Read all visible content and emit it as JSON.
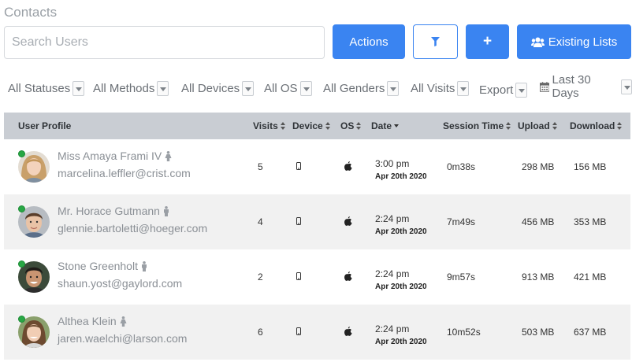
{
  "page": {
    "title": "Contacts"
  },
  "search": {
    "placeholder": "Search Users",
    "value": ""
  },
  "toolbar": {
    "actions_label": "Actions",
    "filter_icon": "filter-icon",
    "add_label": "+",
    "existing_lists_label": "Existing Lists",
    "existing_lists_icon": "users-icon",
    "accent_color": "#3a84f1"
  },
  "filters": {
    "statuses": "All Statuses",
    "methods": "All Methods",
    "devices": "All Devices",
    "os": "All OS",
    "genders": "All Genders",
    "visits": "All Visits",
    "export": "Export",
    "date_range": "Last 30 Days"
  },
  "table": {
    "headers": {
      "profile": "User Profile",
      "visits": "Visits",
      "device": "Device",
      "os": "OS",
      "date": "Date",
      "session": "Session Time",
      "upload": "Upload",
      "download": "Download"
    },
    "rows": [
      {
        "name": "Miss Amaya Frami IV",
        "email": "marcelina.leffler@crist.com",
        "visits": "5",
        "device": "mobile-icon",
        "os": "apple-icon",
        "time": "3:00 pm",
        "date": "Apr 20th 2020",
        "session": "0m38s",
        "upload": "298 MB",
        "download": "156 MB",
        "online": true
      },
      {
        "name": "Mr. Horace Gutmann",
        "email": "glennie.bartoletti@hoeger.com",
        "visits": "4",
        "device": "mobile-icon",
        "os": "apple-icon",
        "time": "2:24 pm",
        "date": "Apr 20th 2020",
        "session": "7m49s",
        "upload": "456 MB",
        "download": "353 MB",
        "online": true
      },
      {
        "name": "Stone Greenholt",
        "email": "shaun.yost@gaylord.com",
        "visits": "2",
        "device": "mobile-icon",
        "os": "apple-icon",
        "time": "2:24 pm",
        "date": "Apr 20th 2020",
        "session": "9m57s",
        "upload": "913 MB",
        "download": "421 MB",
        "online": true
      },
      {
        "name": "Althea Klein",
        "email": "jaren.waelchi@larson.com",
        "visits": "6",
        "device": "mobile-icon",
        "os": "apple-icon",
        "time": "2:24 pm",
        "date": "Apr 20th 2020",
        "session": "10m52s",
        "upload": "503 MB",
        "download": "637 MB",
        "online": true
      }
    ]
  }
}
